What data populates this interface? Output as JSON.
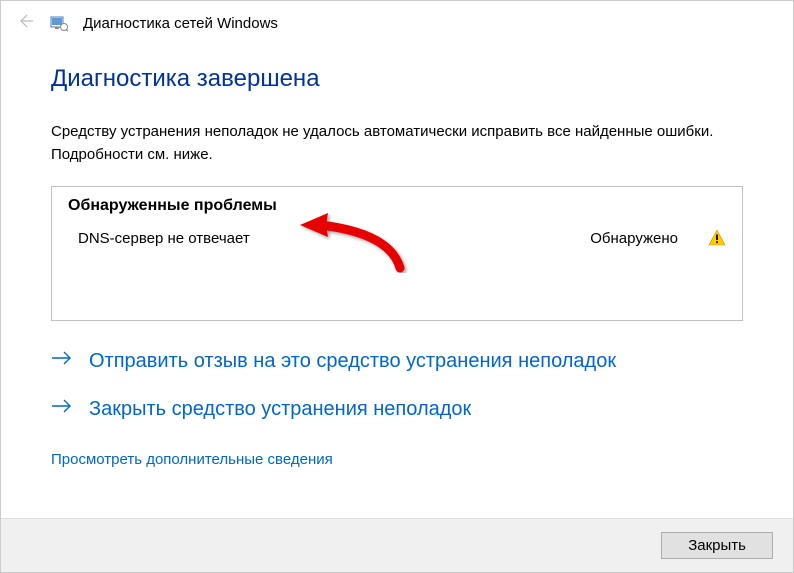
{
  "titlebar": {
    "title": "Диагностика сетей Windows"
  },
  "main": {
    "heading": "Диагностика завершена",
    "description": "Средству устранения неполадок не удалось автоматически исправить все найденные ошибки. Подробности см. ниже.",
    "problems": {
      "header": "Обнаруженные проблемы",
      "items": [
        {
          "name": "DNS-сервер не отвечает",
          "status": "Обнаружено"
        }
      ]
    },
    "actions": {
      "feedback": "Отправить отзыв на это средство устранения неполадок",
      "close_troubleshooter": "Закрыть средство устранения неполадок"
    },
    "details_link": "Просмотреть дополнительные сведения"
  },
  "footer": {
    "close_label": "Закрыть"
  }
}
